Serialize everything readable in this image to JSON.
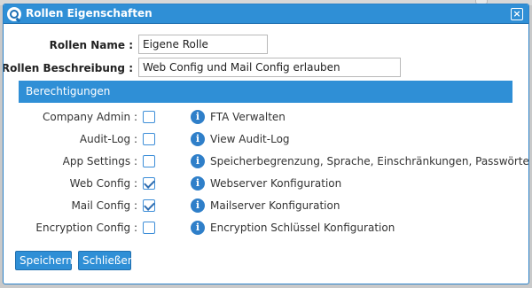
{
  "dialog": {
    "title": "Rollen Eigenschaften",
    "close_symbol": "×",
    "app_icon": "q-logo-icon"
  },
  "form": {
    "name_label": "Rollen Name :",
    "name_value": "Eigene Rolle",
    "description_label": "Rollen Beschreibung :",
    "description_value": "Web Config und Mail Config erlauben"
  },
  "permissions": {
    "header": "Berechtigungen",
    "items": [
      {
        "label": "Company Admin :",
        "checked": false,
        "description": "FTA Verwalten"
      },
      {
        "label": "Audit-Log :",
        "checked": false,
        "description": "View Audit-Log"
      },
      {
        "label": "App Settings :",
        "checked": false,
        "description": "Speicherbegrenzung, Sprache, Einschränkungen, Passwörter"
      },
      {
        "label": "Web Config :",
        "checked": true,
        "description": "Webserver Konfiguration"
      },
      {
        "label": "Mail Config :",
        "checked": true,
        "description": "Mailserver Konfiguration"
      },
      {
        "label": "Encryption Config :",
        "checked": false,
        "description": "Encryption Schlüssel Konfiguration"
      }
    ],
    "info_glyph": "i"
  },
  "buttons": {
    "save_label": "Speichern",
    "close_label": "Schließen"
  },
  "colors": {
    "accent": "#2f8fd6",
    "info": "#2f7fc9"
  }
}
